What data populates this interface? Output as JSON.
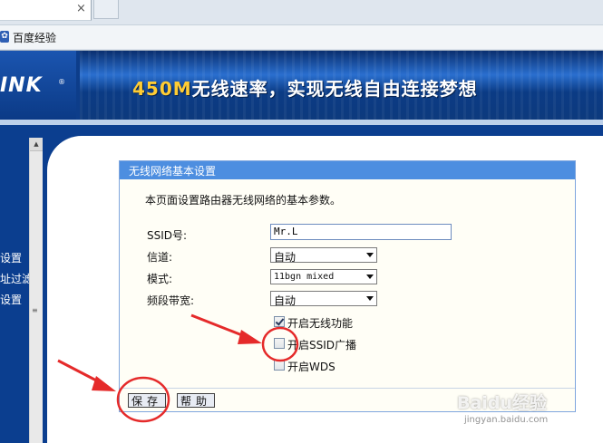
{
  "browser": {
    "tab_close": "×",
    "favorite_item": "百度经验"
  },
  "banner": {
    "logo": "INK",
    "slogan_highlight": "450M",
    "slogan_rest": "无线速率，实现无线自由连接梦想"
  },
  "left_menu": {
    "items": [
      "设置",
      "址过滤",
      "设置"
    ]
  },
  "panel": {
    "title": "无线网络基本设置",
    "description": "本页面设置路由器无线网络的基本参数。",
    "ssid_label": "SSID号:",
    "ssid_value": "Mr.L",
    "channel_label": "信道:",
    "channel_value": "自动",
    "mode_label": "模式:",
    "mode_value": "11bgn mixed",
    "bandwidth_label": "频段带宽:",
    "bandwidth_value": "自动",
    "checkboxes": [
      {
        "label": "开启无线功能",
        "checked": true
      },
      {
        "label": "开启SSID广播",
        "checked": false
      },
      {
        "label": "开启WDS",
        "checked": false
      }
    ],
    "save_label": "保存",
    "help_label": "帮助"
  },
  "watermark": {
    "brand": "Baidu经验",
    "url": "jingyan.baidu.com"
  },
  "colors": {
    "annotation_red": "#e52a2a",
    "panel_header": "#4d8ee0",
    "menu_bg": "#0b3e8f"
  }
}
